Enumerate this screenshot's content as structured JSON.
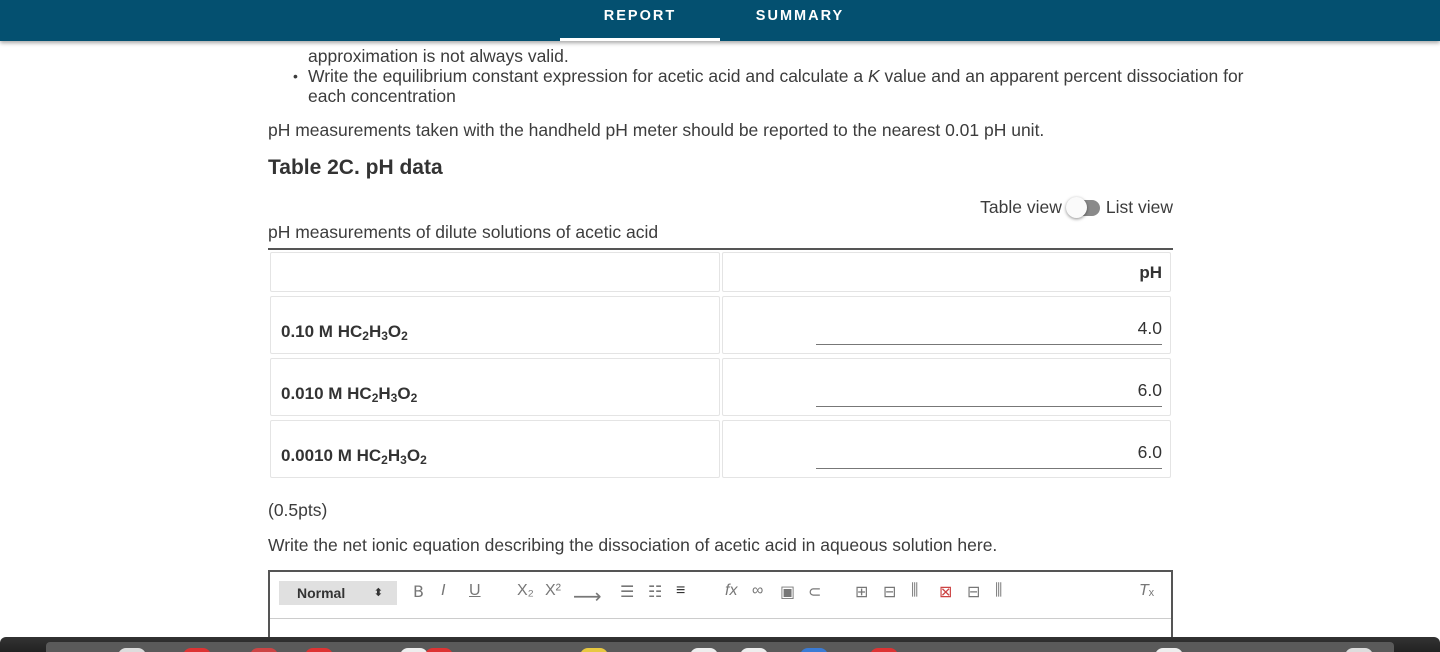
{
  "header": {
    "tabs": [
      {
        "label": "REPORT",
        "active": true
      },
      {
        "label": "SUMMARY",
        "active": false
      }
    ]
  },
  "intro": {
    "bullet_fragment": "approximation is not always valid.",
    "bullet2_line1_prefix": "Write the equilibrium constant expression for acetic acid and calculate a ",
    "bullet2_k": "K",
    "bullet2_line1_suffix": " value and an apparent percent dissociation for",
    "bullet2_line2": "each concentration",
    "ph_note": "pH measurements taken with the handheld pH meter should be reported to the nearest 0.01 pH unit."
  },
  "table": {
    "title": "Table 2C. pH data",
    "toggle_left": "Table view",
    "toggle_right": "List view",
    "caption": "pH measurements of dilute solutions of acetic acid",
    "column_header": "pH",
    "rows": [
      {
        "conc": "0.10 M HC",
        "value": "4.0"
      },
      {
        "conc": "0.010 M HC",
        "value": "6.0"
      },
      {
        "conc": "0.0010 M HC",
        "value": "6.0"
      }
    ],
    "formula": {
      "s1": "2",
      "h": "H",
      "s2": "3",
      "o": "O",
      "s3": "2"
    }
  },
  "question": {
    "points": "(0.5pts)",
    "prompt": "Write the net ionic equation describing the dissociation of acetic acid in aqueous solution here."
  },
  "editor": {
    "format_value": "Normal",
    "tools": [
      "bold-icon",
      "italic-icon",
      "underline-icon",
      "subscript-icon",
      "superscript-icon",
      "arrow-icon",
      "ordered-list-icon",
      "bullet-list-icon",
      "align-icon",
      "formula-icon",
      "link-icon",
      "image-icon",
      "attach-icon",
      "table-icon",
      "table-insert-row-icon",
      "table-insert-col-icon",
      "table-delete-icon",
      "table-delete-row-icon",
      "table-delete-col-icon",
      "clear-format-icon"
    ]
  },
  "colors": {
    "header_bg": "#045070",
    "text": "#3c3c3c"
  }
}
